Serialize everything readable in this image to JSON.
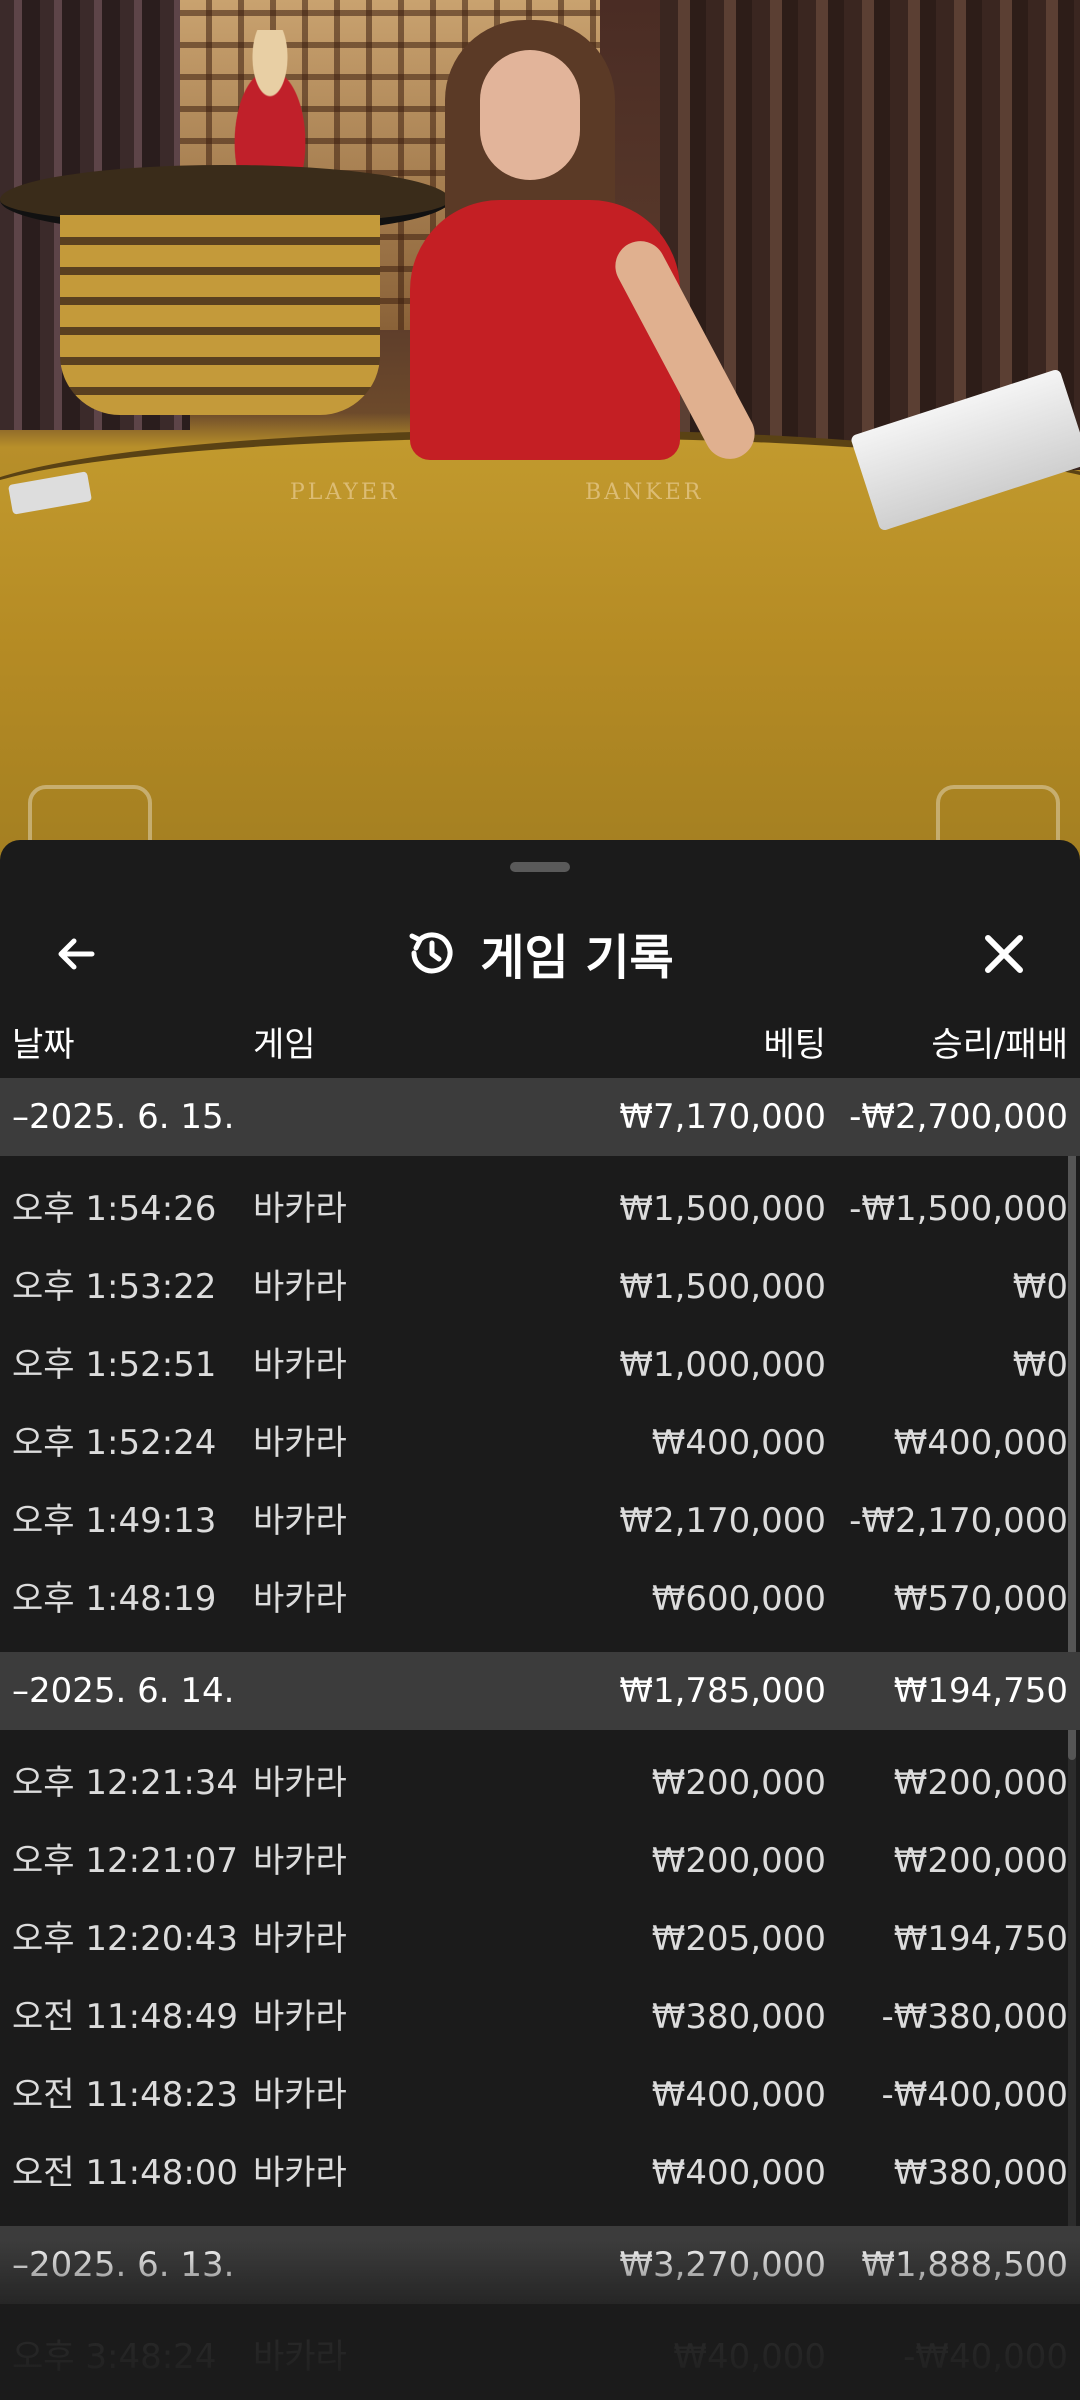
{
  "scene": {
    "table_labels": [
      "PLAYER",
      "BANKER"
    ]
  },
  "sheet": {
    "title": "게임 기록",
    "icons": {
      "back": "arrow-left-icon",
      "history": "history-clock-icon",
      "close": "close-icon"
    },
    "columns": {
      "date": "날짜",
      "game": "게임",
      "bet": "베팅",
      "result": "승리/패배"
    },
    "groups": [
      {
        "date": "–2025. 6. 15.",
        "bet": "₩7,170,000",
        "result": "-₩2,700,000",
        "rows": [
          {
            "time": "오후 1:54:26",
            "game": "바카라",
            "bet": "₩1,500,000",
            "result": "-₩1,500,000"
          },
          {
            "time": "오후 1:53:22",
            "game": "바카라",
            "bet": "₩1,500,000",
            "result": "₩0"
          },
          {
            "time": "오후 1:52:51",
            "game": "바카라",
            "bet": "₩1,000,000",
            "result": "₩0"
          },
          {
            "time": "오후 1:52:24",
            "game": "바카라",
            "bet": "₩400,000",
            "result": "₩400,000"
          },
          {
            "time": "오후 1:49:13",
            "game": "바카라",
            "bet": "₩2,170,000",
            "result": "-₩2,170,000"
          },
          {
            "time": "오후 1:48:19",
            "game": "바카라",
            "bet": "₩600,000",
            "result": "₩570,000"
          }
        ]
      },
      {
        "date": "–2025. 6. 14.",
        "bet": "₩1,785,000",
        "result": "₩194,750",
        "rows": [
          {
            "time": "오후 12:21:34",
            "game": "바카라",
            "bet": "₩200,000",
            "result": "₩200,000"
          },
          {
            "time": "오후 12:21:07",
            "game": "바카라",
            "bet": "₩200,000",
            "result": "₩200,000"
          },
          {
            "time": "오후 12:20:43",
            "game": "바카라",
            "bet": "₩205,000",
            "result": "₩194,750"
          },
          {
            "time": "오전 11:48:49",
            "game": "바카라",
            "bet": "₩380,000",
            "result": "-₩380,000"
          },
          {
            "time": "오전 11:48:23",
            "game": "바카라",
            "bet": "₩400,000",
            "result": "-₩400,000"
          },
          {
            "time": "오전 11:48:00",
            "game": "바카라",
            "bet": "₩400,000",
            "result": "₩380,000"
          }
        ]
      },
      {
        "date": "–2025. 6. 13.",
        "bet": "₩3,270,000",
        "result": "₩1,888,500",
        "rows": [
          {
            "time": "오후 3:48:24",
            "game": "바카라",
            "bet": "₩40,000",
            "result": "-₩40,000"
          }
        ]
      }
    ]
  }
}
